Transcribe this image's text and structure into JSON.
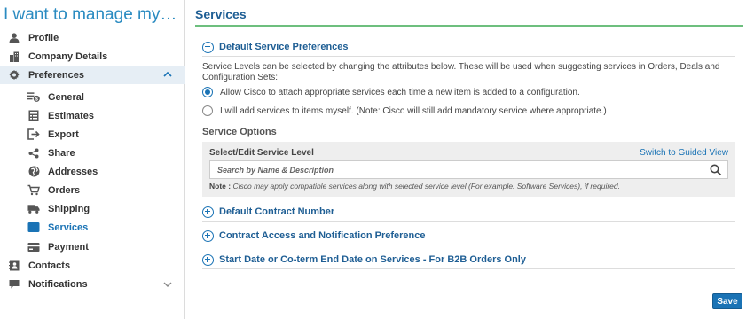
{
  "sidebar": {
    "title": "I want to manage my…",
    "items": [
      {
        "label": "Profile",
        "icon": "person-icon"
      },
      {
        "label": "Company Details",
        "icon": "building-icon"
      },
      {
        "label": "Preferences",
        "icon": "gear-icon"
      },
      {
        "label": "Contacts",
        "icon": "contacts-icon"
      },
      {
        "label": "Notifications",
        "icon": "chat-icon"
      }
    ],
    "sub_items": [
      {
        "label": "General",
        "icon": "general-icon"
      },
      {
        "label": "Estimates",
        "icon": "calculator-icon"
      },
      {
        "label": "Export",
        "icon": "export-icon"
      },
      {
        "label": "Share",
        "icon": "share-icon"
      },
      {
        "label": "Addresses",
        "icon": "globe-icon"
      },
      {
        "label": "Orders",
        "icon": "cart-icon"
      },
      {
        "label": "Shipping",
        "icon": "truck-icon"
      },
      {
        "label": "Services",
        "icon": "services-icon"
      },
      {
        "label": "Payment",
        "icon": "card-icon"
      }
    ],
    "active_item": "Preferences",
    "active_sub_item": "Services"
  },
  "main": {
    "title": "Services",
    "default_prefs": {
      "heading": "Default Service Preferences",
      "description": "Service Levels can be selected by changing the attributes below. These will be used when suggesting services in Orders, Deals and Configuration Sets:",
      "options": [
        {
          "label": "Allow Cisco to attach appropriate services each time a new item is added to a configuration.",
          "checked": true
        },
        {
          "label": "I will add services to items myself. (Note: Cisco will still add mandatory service where appropriate.)",
          "checked": false
        }
      ]
    },
    "service_options": {
      "title": "Service Options",
      "select_label": "Select/Edit Service Level",
      "guided_link": "Switch to Guided View",
      "search_placeholder": "Search by Name & Description",
      "note_label": "Note :",
      "note_text": "Cisco may apply compatible services along with selected service level (For example: Software Services), if required."
    },
    "sections": [
      {
        "heading": "Default Contract Number"
      },
      {
        "heading": "Contract Access and Notification Preference"
      },
      {
        "heading": "Start Date or Co-term End Date on Services - For B2B Orders Only"
      }
    ],
    "save_label": "Save"
  },
  "colors": {
    "accent": "#1a73b5",
    "title_blue": "#1e5e94",
    "rule_green": "#6dbf7e",
    "active_bg": "#e6eef5"
  }
}
